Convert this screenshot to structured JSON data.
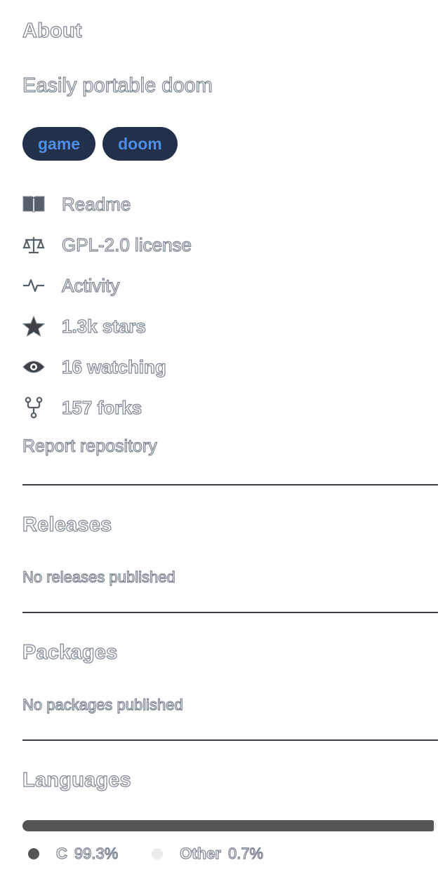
{
  "about": {
    "title": "About",
    "description": "Easily portable doom",
    "topics": [
      "game",
      "doom"
    ],
    "meta": [
      {
        "icon": "book-icon",
        "label": "Readme"
      },
      {
        "icon": "law-scale-icon",
        "label": "GPL-2.0 license"
      },
      {
        "icon": "pulse-icon",
        "label": "Activity"
      },
      {
        "icon": "star-icon",
        "label": "1.3k stars"
      },
      {
        "icon": "eye-icon",
        "label": "16 watching"
      },
      {
        "icon": "repo-forked-icon",
        "label": "157 forks"
      }
    ],
    "report_link": "Report repository"
  },
  "releases": {
    "title": "Releases",
    "note": "No releases published"
  },
  "packages": {
    "title": "Packages",
    "note": "No packages published"
  },
  "languages": {
    "title": "Languages",
    "items": [
      {
        "name": "C",
        "percent_label": "99.3%",
        "percent": 99.3,
        "color": "#555555"
      },
      {
        "name": "Other",
        "percent_label": "0.7%",
        "percent": 0.7,
        "color": "#ededed"
      }
    ]
  },
  "colors": {
    "topic_bg": "#22304a",
    "topic_text": "#4d8fe8",
    "divider": "#3a3f47",
    "icon": "#57606a"
  }
}
